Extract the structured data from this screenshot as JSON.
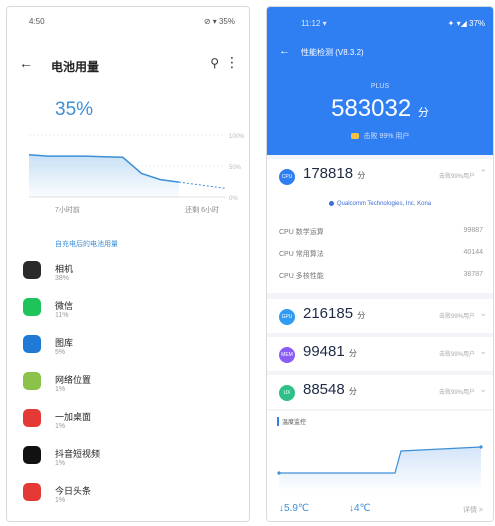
{
  "left": {
    "status_time": "4:50",
    "status_icons": "⊘ ▾ 35%",
    "title": "电池用量",
    "percent": "35%",
    "chart": {
      "axis_ticks": [
        "100%",
        "50%",
        "0%"
      ],
      "x_start": "7小时前",
      "x_end": "还剩 6小时",
      "levels": [
        68,
        66,
        66,
        66,
        65,
        64,
        38,
        28,
        24
      ],
      "projection": [
        24,
        14
      ]
    },
    "section_label": "自充电后的电池用量",
    "apps": [
      {
        "name": "相机",
        "pct": "38%",
        "color": "#2a2a2a",
        "icon": "camera-icon"
      },
      {
        "name": "微信",
        "pct": "11%",
        "color": "#1ec35a",
        "icon": "wechat-icon"
      },
      {
        "name": "图库",
        "pct": "5%",
        "color": "#1f7ad6",
        "icon": "gallery-icon"
      },
      {
        "name": "网络位置",
        "pct": "1%",
        "color": "#8bc34a",
        "icon": "android-icon"
      },
      {
        "name": "一加桌面",
        "pct": "1%",
        "color": "#e53935",
        "icon": "launcher-icon"
      },
      {
        "name": "抖音短视频",
        "pct": "1%",
        "color": "#111111",
        "icon": "douyin-icon"
      },
      {
        "name": "今日头条",
        "pct": "1%",
        "color": "#e53935",
        "icon": "toutiao-icon"
      }
    ]
  },
  "right": {
    "status_time": "11:12 ▾",
    "status_icons": "✦ ▾◢ 37%",
    "title": "性能检测 (V8.3.2)",
    "device": "PLUS",
    "total_score": "583032",
    "score_unit": "分",
    "rank_text": "击败 99% 用户",
    "cpu": {
      "score": "178818",
      "badge": "CPU",
      "note": "击败99%用户"
    },
    "info_strip": "Qualcomm Technologies, Inc. Kona",
    "cpu_rows": [
      {
        "label": "CPU 数学运算",
        "value": "99887"
      },
      {
        "label": "CPU 常用算法",
        "value": "40144"
      },
      {
        "label": "CPU 多核性能",
        "value": "38787"
      }
    ],
    "gpu": {
      "score": "216185",
      "badge": "GPU",
      "note": "击败99%用户"
    },
    "mem": {
      "score": "99481",
      "badge": "MEM",
      "note": "击败99%用户"
    },
    "ux": {
      "score": "88548",
      "badge": "UX",
      "note": "击败99%用户"
    },
    "graph_title": "温度监控",
    "temp_start": "↓5.9℃",
    "temp_end": "↓4℃",
    "temp_more": "详情 >",
    "colors": {
      "cpu": "#2f7ff2",
      "gpu": "#2f9bf2",
      "mem": "#8a5cf6",
      "ux": "#2fbf88"
    }
  }
}
